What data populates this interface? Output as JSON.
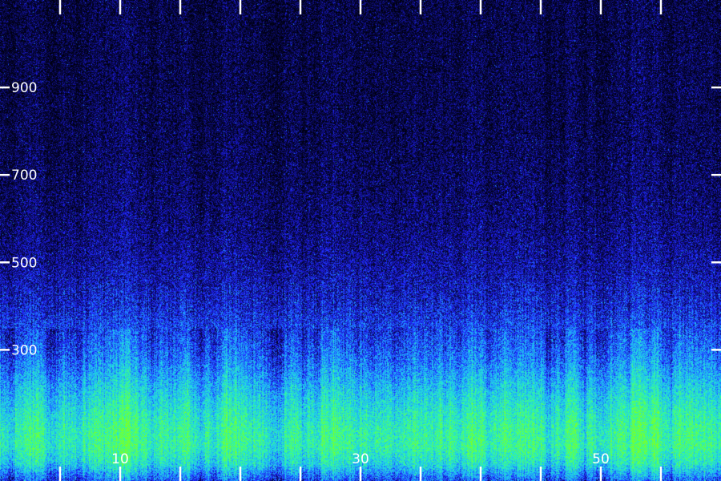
{
  "chart_data": {
    "type": "heatmap",
    "title": "",
    "xlabel": "",
    "ylabel": "",
    "xlim": [
      0,
      60
    ],
    "ylim": [
      0,
      1100
    ],
    "x_ticks": [
      5,
      10,
      15,
      20,
      25,
      30,
      35,
      40,
      45,
      50,
      55
    ],
    "x_tick_labels": [
      {
        "value": 10,
        "label": "10"
      },
      {
        "value": 30,
        "label": "30"
      },
      {
        "value": 50,
        "label": "50"
      }
    ],
    "y_ticks": [
      {
        "value": 900,
        "label": "900"
      },
      {
        "value": 700,
        "label": "700"
      },
      {
        "value": 500,
        "label": "500"
      },
      {
        "value": 300,
        "label": "300"
      }
    ],
    "grid": false,
    "colormap": [
      "#000010",
      "#0a0a5a",
      "#2020ff",
      "#20a0ff",
      "#20e0e0",
      "#40ff80",
      "#80ff20"
    ],
    "intensity_profile": {
      "freq": [
        0,
        40,
        80,
        120,
        160,
        200,
        240,
        280,
        320,
        360,
        400,
        450,
        500,
        600,
        700,
        800,
        900,
        1100
      ],
      "level": [
        0.4,
        0.68,
        0.8,
        0.78,
        0.72,
        0.64,
        0.55,
        0.46,
        0.4,
        0.35,
        0.3,
        0.26,
        0.22,
        0.17,
        0.14,
        0.12,
        0.11,
        0.1
      ]
    }
  }
}
